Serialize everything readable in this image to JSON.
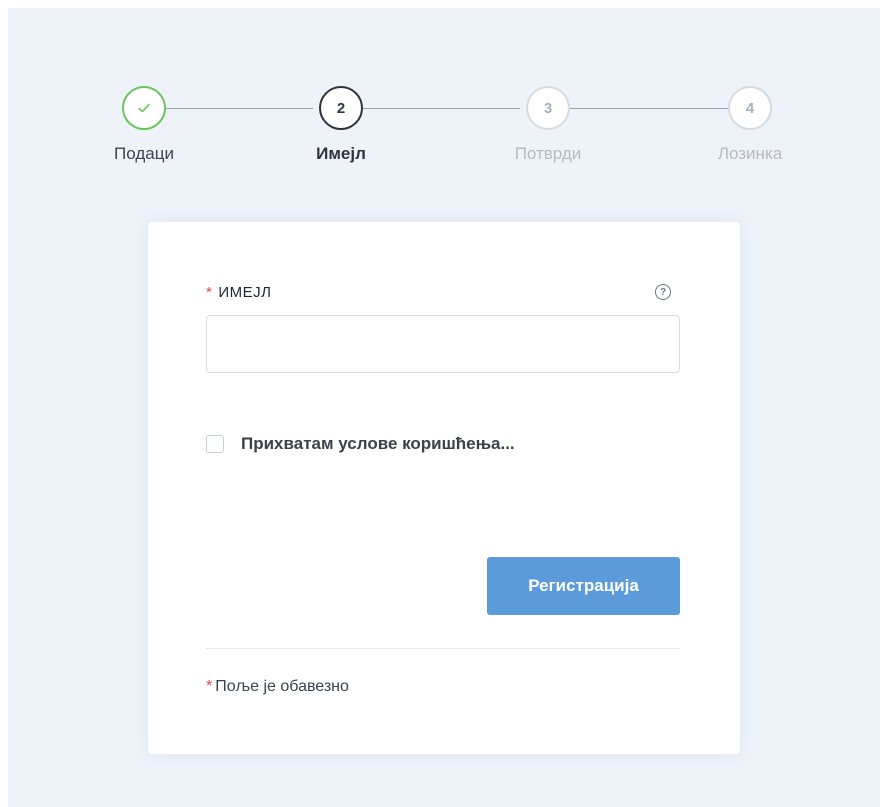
{
  "stepper": {
    "steps": [
      {
        "number": "",
        "label": "Подаци",
        "state": "done"
      },
      {
        "number": "2",
        "label": "Имејл",
        "state": "active"
      },
      {
        "number": "3",
        "label": "Потврди",
        "state": "pending"
      },
      {
        "number": "4",
        "label": "Лозинка",
        "state": "pending"
      }
    ]
  },
  "form": {
    "required_mark": "*",
    "email_label": "ИМЕЈЛ",
    "help_icon_glyph": "?",
    "email_value": "",
    "email_placeholder": "",
    "terms_label": "Прихватам услове коришћења...",
    "register_label": "Регистрација",
    "required_note": "Поље је обавезно"
  },
  "colors": {
    "page_background": "#eef3fa",
    "done": "#6cc25b",
    "active": "#2d3440",
    "pending": "#b4bbc3",
    "required": "#e5484d",
    "primary_button": "#5b9bd9"
  }
}
